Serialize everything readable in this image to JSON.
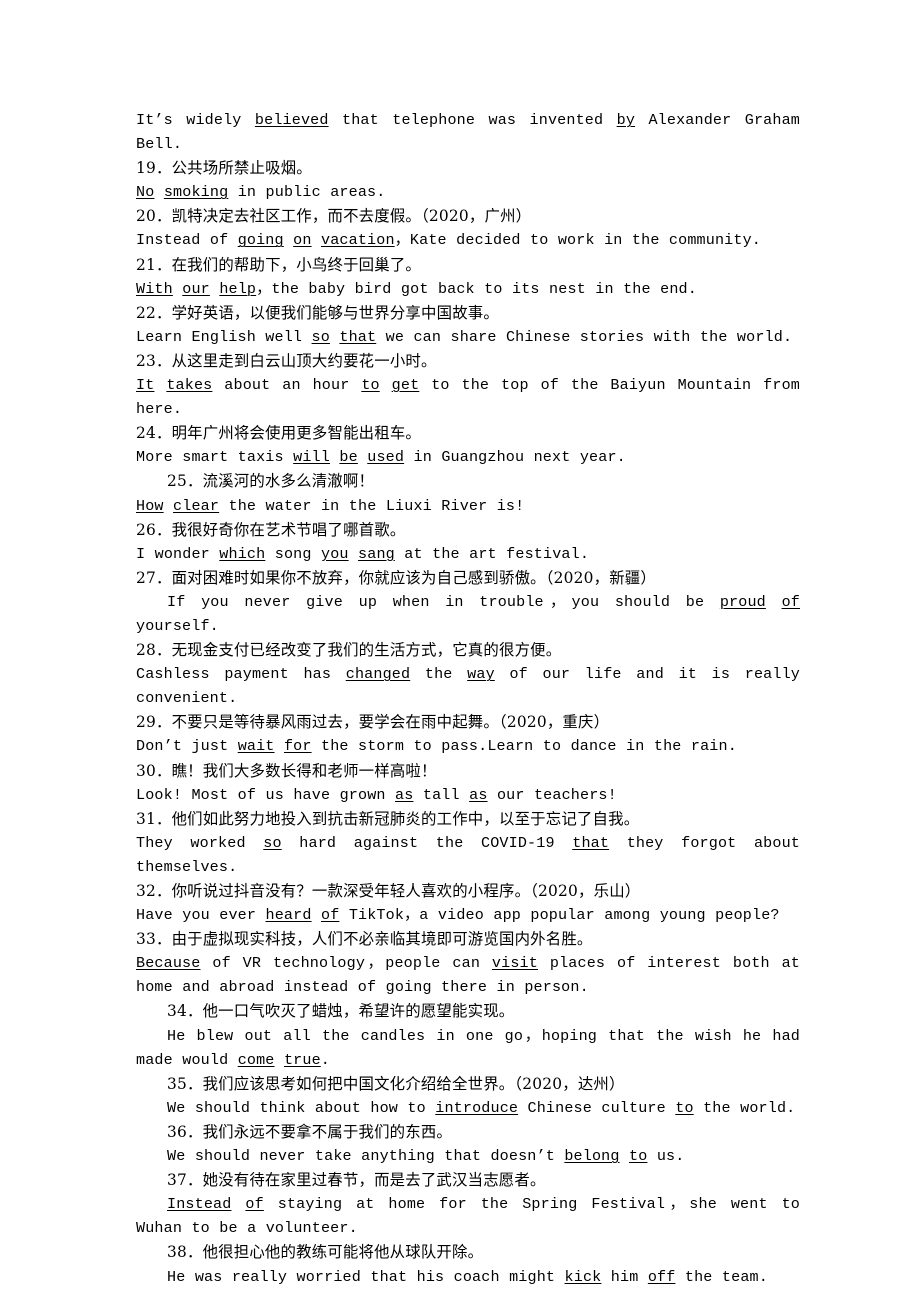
{
  "document": {
    "type": "answer-key-worksheet",
    "language_pair": "zh-en",
    "entries": [
      {
        "id": "entry-18-answer",
        "kind": "english",
        "indent": false,
        "segments": [
          {
            "t": "It",
            "u": false
          },
          {
            "t": "’s widely ",
            "u": false
          },
          {
            "t": "believed",
            "u": true
          },
          {
            "t": " that telephone was invented ",
            "u": false
          },
          {
            "t": "by",
            "u": true
          },
          {
            "t": " Alexander Graham Bell.",
            "u": false
          }
        ]
      },
      {
        "id": "entry-19-prompt",
        "kind": "chinese",
        "indent": false,
        "segments": [
          {
            "t": "19．公共场所禁止吸烟。",
            "u": false
          }
        ]
      },
      {
        "id": "entry-19-answer",
        "kind": "english",
        "indent": false,
        "segments": [
          {
            "t": "No",
            "u": true
          },
          {
            "t": " ",
            "u": false
          },
          {
            "t": "smoking",
            "u": true
          },
          {
            "t": " in public areas.",
            "u": false
          }
        ]
      },
      {
        "id": "entry-20-prompt",
        "kind": "chinese",
        "indent": false,
        "segments": [
          {
            "t": "20．凯特决定去社区工作，而不去度假。（2020，广州）",
            "u": false
          }
        ]
      },
      {
        "id": "entry-20-answer",
        "kind": "english",
        "indent": false,
        "segments": [
          {
            "t": "Instead of ",
            "u": false
          },
          {
            "t": "going",
            "u": true
          },
          {
            "t": " ",
            "u": false
          },
          {
            "t": "on",
            "u": true
          },
          {
            "t": " ",
            "u": false
          },
          {
            "t": "vacation",
            "u": true
          },
          {
            "t": "，Kate decided to work in the community.",
            "u": false
          }
        ]
      },
      {
        "id": "entry-21-prompt",
        "kind": "chinese",
        "indent": false,
        "segments": [
          {
            "t": "21．在我们的帮助下，小鸟终于回巢了。",
            "u": false
          }
        ]
      },
      {
        "id": "entry-21-answer",
        "kind": "english",
        "indent": false,
        "segments": [
          {
            "t": "With",
            "u": true
          },
          {
            "t": " ",
            "u": false
          },
          {
            "t": "our",
            "u": true
          },
          {
            "t": " ",
            "u": false
          },
          {
            "t": "help",
            "u": true
          },
          {
            "t": "，the baby bird got back to its nest in the end.",
            "u": false
          }
        ]
      },
      {
        "id": "entry-22-prompt",
        "kind": "chinese",
        "indent": false,
        "segments": [
          {
            "t": "22．学好英语，以便我们能够与世界分享中国故事。",
            "u": false
          }
        ]
      },
      {
        "id": "entry-22-answer",
        "kind": "english",
        "indent": false,
        "segments": [
          {
            "t": "Learn English well ",
            "u": false
          },
          {
            "t": "so",
            "u": true
          },
          {
            "t": " ",
            "u": false
          },
          {
            "t": "that",
            "u": true
          },
          {
            "t": " we can share Chinese stories with the world.",
            "u": false
          }
        ]
      },
      {
        "id": "entry-23-prompt",
        "kind": "chinese",
        "indent": false,
        "segments": [
          {
            "t": "23．从这里走到白云山顶大约要花一小时。",
            "u": false
          }
        ]
      },
      {
        "id": "entry-23-answer",
        "kind": "english",
        "indent": false,
        "segments": [
          {
            "t": "It",
            "u": true
          },
          {
            "t": " ",
            "u": false
          },
          {
            "t": "takes",
            "u": true
          },
          {
            "t": " about an hour ",
            "u": false
          },
          {
            "t": "to",
            "u": true
          },
          {
            "t": " ",
            "u": false
          },
          {
            "t": "get",
            "u": true
          },
          {
            "t": " to the top of the Baiyun Mountain from here.",
            "u": false
          }
        ]
      },
      {
        "id": "entry-24-prompt",
        "kind": "chinese",
        "indent": false,
        "segments": [
          {
            "t": "24．明年广州将会使用更多智能出租车。",
            "u": false
          }
        ]
      },
      {
        "id": "entry-24-answer",
        "kind": "english",
        "indent": false,
        "segments": [
          {
            "t": "More smart taxis ",
            "u": false
          },
          {
            "t": "will",
            "u": true
          },
          {
            "t": " ",
            "u": false
          },
          {
            "t": "be",
            "u": true
          },
          {
            "t": " ",
            "u": false
          },
          {
            "t": "used",
            "u": true
          },
          {
            "t": " in Guangzhou next year.",
            "u": false
          }
        ]
      },
      {
        "id": "entry-25-prompt",
        "kind": "chinese",
        "indent": true,
        "segments": [
          {
            "t": "25．流溪河的水多么清澈啊！",
            "u": false
          }
        ]
      },
      {
        "id": "entry-25-answer",
        "kind": "english",
        "indent": false,
        "segments": [
          {
            "t": "How",
            "u": true
          },
          {
            "t": " ",
            "u": false
          },
          {
            "t": "clear",
            "u": true
          },
          {
            "t": " the water in the Liuxi River is!",
            "u": false
          }
        ]
      },
      {
        "id": "entry-26-prompt",
        "kind": "chinese",
        "indent": false,
        "segments": [
          {
            "t": "26．我很好奇你在艺术节唱了哪首歌。",
            "u": false
          }
        ]
      },
      {
        "id": "entry-26-answer",
        "kind": "english",
        "indent": false,
        "segments": [
          {
            "t": "I wonder ",
            "u": false
          },
          {
            "t": "which",
            "u": true
          },
          {
            "t": " song ",
            "u": false
          },
          {
            "t": "you",
            "u": true
          },
          {
            "t": " ",
            "u": false
          },
          {
            "t": "sang",
            "u": true
          },
          {
            "t": " at the art festival.",
            "u": false
          }
        ]
      },
      {
        "id": "entry-27-prompt",
        "kind": "chinese",
        "indent": false,
        "segments": [
          {
            "t": "27．面对困难时如果你不放弃，你就应该为自己感到骄傲。（2020，新疆）",
            "u": false
          }
        ]
      },
      {
        "id": "entry-27-answer",
        "kind": "english",
        "indent": true,
        "segments": [
          {
            "t": "If you never give up when in trouble，you should be ",
            "u": false
          },
          {
            "t": "proud",
            "u": true
          },
          {
            "t": " ",
            "u": false
          },
          {
            "t": "of",
            "u": true
          },
          {
            "t": " yourself.",
            "u": false
          }
        ]
      },
      {
        "id": "entry-28-prompt",
        "kind": "chinese",
        "indent": false,
        "segments": [
          {
            "t": "28．无现金支付已经改变了我们的生活方式，它真的很方便。",
            "u": false
          }
        ]
      },
      {
        "id": "entry-28-answer",
        "kind": "english",
        "indent": false,
        "segments": [
          {
            "t": "Cashless payment has ",
            "u": false
          },
          {
            "t": "changed",
            "u": true
          },
          {
            "t": " the ",
            "u": false
          },
          {
            "t": "way",
            "u": true
          },
          {
            "t": " of our life and it is really convenient.",
            "u": false
          }
        ]
      },
      {
        "id": "entry-29-prompt",
        "kind": "chinese",
        "indent": false,
        "segments": [
          {
            "t": "29．不要只是等待暴风雨过去，要学会在雨中起舞。（2020，重庆）",
            "u": false
          }
        ]
      },
      {
        "id": "entry-29-answer",
        "kind": "english",
        "indent": false,
        "segments": [
          {
            "t": "Don’t just ",
            "u": false
          },
          {
            "t": "wait",
            "u": true
          },
          {
            "t": " ",
            "u": false
          },
          {
            "t": "for",
            "u": true
          },
          {
            "t": " the storm to pass.Learn to dance in the rain.",
            "u": false
          }
        ]
      },
      {
        "id": "entry-30-prompt",
        "kind": "chinese",
        "indent": false,
        "segments": [
          {
            "t": "30．瞧！我们大多数长得和老师一样高啦！",
            "u": false
          }
        ]
      },
      {
        "id": "entry-30-answer",
        "kind": "english",
        "indent": false,
        "segments": [
          {
            "t": "Look! Most of us have grown ",
            "u": false
          },
          {
            "t": "as",
            "u": true
          },
          {
            "t": " tall ",
            "u": false
          },
          {
            "t": "as",
            "u": true
          },
          {
            "t": " our teachers!",
            "u": false
          }
        ]
      },
      {
        "id": "entry-31-prompt",
        "kind": "chinese",
        "indent": false,
        "segments": [
          {
            "t": "31．他们如此努力地投入到抗击新冠肺炎的工作中，以至于忘记了自我。",
            "u": false
          }
        ]
      },
      {
        "id": "entry-31-answer",
        "kind": "english",
        "indent": false,
        "segments": [
          {
            "t": "They worked ",
            "u": false
          },
          {
            "t": "so",
            "u": true
          },
          {
            "t": " hard against the COVID-19 ",
            "u": false
          },
          {
            "t": "that",
            "u": true
          },
          {
            "t": " they forgot about themselves.",
            "u": false
          }
        ]
      },
      {
        "id": "entry-32-prompt",
        "kind": "chinese",
        "indent": false,
        "segments": [
          {
            "t": "32．你听说过抖音没有？一款深受年轻人喜欢的小程序。（2020，乐山）",
            "u": false
          }
        ]
      },
      {
        "id": "entry-32-answer",
        "kind": "english",
        "indent": false,
        "segments": [
          {
            "t": "Have you ever ",
            "u": false
          },
          {
            "t": "heard",
            "u": true
          },
          {
            "t": " ",
            "u": false
          },
          {
            "t": "of",
            "u": true
          },
          {
            "t": " TikTok，a video app popular among young people?",
            "u": false
          }
        ]
      },
      {
        "id": "entry-33-prompt",
        "kind": "chinese",
        "indent": false,
        "segments": [
          {
            "t": "33．由于虚拟现实科技，人们不必亲临其境即可游览国内外名胜。",
            "u": false
          }
        ]
      },
      {
        "id": "entry-33-answer",
        "kind": "english",
        "indent": false,
        "wrap": true,
        "segments": [
          {
            "t": "Because",
            "u": true
          },
          {
            "t": " of VR technology，people can ",
            "u": false
          },
          {
            "t": "visit",
            "u": true
          },
          {
            "t": " places of interest both at home and abroad instead of going there in person.",
            "u": false
          }
        ]
      },
      {
        "id": "entry-34-prompt",
        "kind": "chinese",
        "indent": true,
        "segments": [
          {
            "t": "34．他一口气吹灭了蜡烛，希望许的愿望能实现。",
            "u": false
          }
        ]
      },
      {
        "id": "entry-34-answer",
        "kind": "english",
        "indent": true,
        "wrap": true,
        "segments": [
          {
            "t": "He blew out all the candles in one go，hoping that the wish he had made would ",
            "u": false
          },
          {
            "t": "come",
            "u": true
          },
          {
            "t": " ",
            "u": false
          },
          {
            "t": "true",
            "u": true
          },
          {
            "t": ".",
            "u": false
          }
        ]
      },
      {
        "id": "entry-35-prompt",
        "kind": "chinese",
        "indent": true,
        "segments": [
          {
            "t": "35．我们应该思考如何把中国文化介绍给全世界。（2020，达州）",
            "u": false
          }
        ]
      },
      {
        "id": "entry-35-answer",
        "kind": "english",
        "indent": true,
        "segments": [
          {
            "t": "We should think about how to ",
            "u": false
          },
          {
            "t": "introduce",
            "u": true
          },
          {
            "t": " Chinese culture ",
            "u": false
          },
          {
            "t": "to",
            "u": true
          },
          {
            "t": " the world.",
            "u": false
          }
        ]
      },
      {
        "id": "entry-36-prompt",
        "kind": "chinese",
        "indent": true,
        "segments": [
          {
            "t": "36．我们永远不要拿不属于我们的东西。",
            "u": false
          }
        ]
      },
      {
        "id": "entry-36-answer",
        "kind": "english",
        "indent": true,
        "segments": [
          {
            "t": "We should never take anything that doesn’t ",
            "u": false
          },
          {
            "t": "belong",
            "u": true
          },
          {
            "t": " ",
            "u": false
          },
          {
            "t": "to",
            "u": true
          },
          {
            "t": " us.",
            "u": false
          }
        ]
      },
      {
        "id": "entry-37-prompt",
        "kind": "chinese",
        "indent": true,
        "segments": [
          {
            "t": "37．她没有待在家里过春节，而是去了武汉当志愿者。",
            "u": false
          }
        ]
      },
      {
        "id": "entry-37-answer",
        "kind": "english",
        "indent": true,
        "wrap": true,
        "segments": [
          {
            "t": "Instead",
            "u": true
          },
          {
            "t": " ",
            "u": false
          },
          {
            "t": "of",
            "u": true
          },
          {
            "t": " staying at home for the Spring Festival，she went to Wuhan to be a volunteer.",
            "u": false
          }
        ]
      },
      {
        "id": "entry-38-prompt",
        "kind": "chinese",
        "indent": true,
        "segments": [
          {
            "t": "38．他很担心他的教练可能将他从球队开除。",
            "u": false
          }
        ]
      },
      {
        "id": "entry-38-answer",
        "kind": "english",
        "indent": true,
        "segments": [
          {
            "t": "He was really worried that his coach might ",
            "u": false
          },
          {
            "t": "kick",
            "u": true
          },
          {
            "t": " him ",
            "u": false
          },
          {
            "t": "off",
            "u": true
          },
          {
            "t": " the team.",
            "u": false
          }
        ]
      }
    ]
  }
}
